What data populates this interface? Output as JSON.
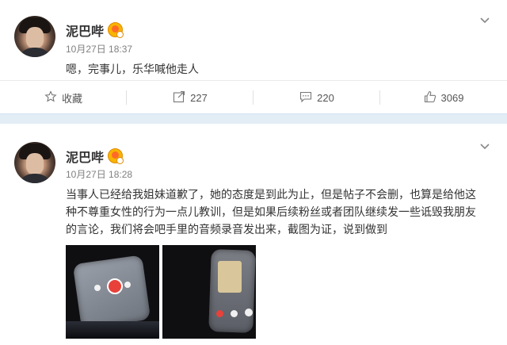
{
  "posts": [
    {
      "username": "泥巴哔",
      "time": "10月27日 18:37",
      "text": "嗯，完事儿，乐华喊他走人",
      "actions": {
        "favorite_label": "收藏",
        "repost_count": "227",
        "comment_count": "220",
        "like_count": "3069"
      }
    },
    {
      "username": "泥巴哔",
      "time": "10月27日 18:28",
      "text": "当事人已经给我姐妹道歉了，她的态度是到此为止，但是帖子不会删，也算是给他这种不尊重女性的行为一点儿教训，但是如果后续粉丝或者团队继续发一些诋毁我朋友的言论，我们将会吧手里的音频录音发出来，截图为证，说到做到"
    }
  ],
  "icons": {
    "avatar": "avatar-photo",
    "badge": "verified-badge-icon",
    "menu": "chevron-down-icon",
    "favorite": "star-icon",
    "repost": "repost-icon",
    "comment": "comment-icon",
    "like": "thumbs-up-icon"
  },
  "colors": {
    "divider": "#e2edf6",
    "text": "#333333",
    "muted": "#808080",
    "badge": "#f7b500"
  }
}
